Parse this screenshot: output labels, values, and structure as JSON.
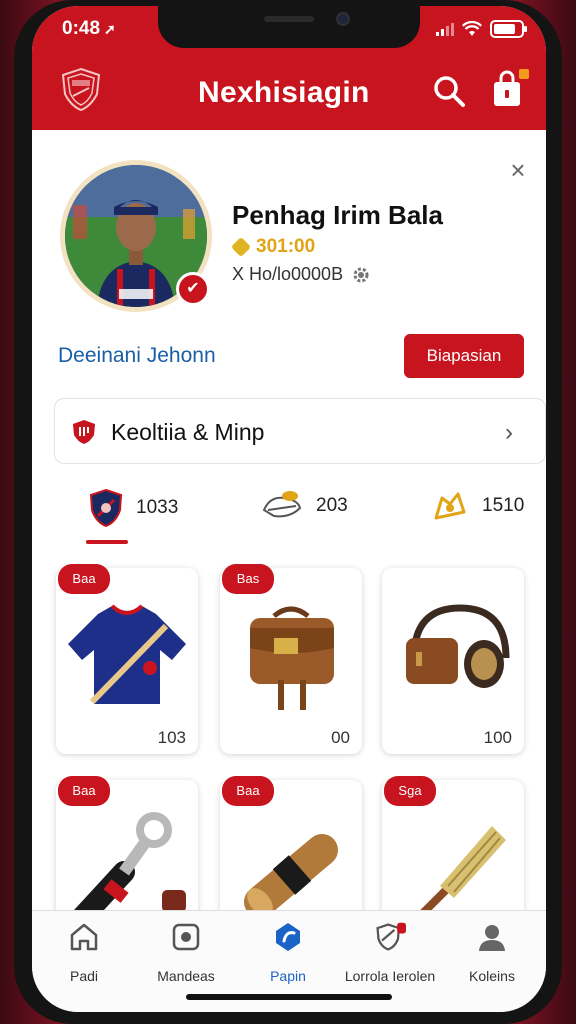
{
  "status": {
    "time": "0:48",
    "arrow": "➚"
  },
  "header": {
    "title": "Nexhisiagin"
  },
  "profile": {
    "name": "Penhag Irim Bala",
    "coins": "301:00",
    "id": "X Ho/lo0000B",
    "link": "Deeinani Jehonn",
    "action_label": "Biapasian"
  },
  "promo": {
    "label": "Keoltiia & Minp"
  },
  "stats": [
    {
      "value": "1033"
    },
    {
      "value": "203"
    },
    {
      "value": "1510"
    }
  ],
  "products": [
    {
      "tag": "Baa",
      "count": "103",
      "icon": "jersey-icon"
    },
    {
      "tag": "Bas",
      "count": "00",
      "icon": "satchel-icon"
    },
    {
      "tag": "",
      "count": "100",
      "icon": "headphones-icon"
    },
    {
      "tag": "Baa",
      "count": "",
      "icon": "bottle-opener-icon"
    },
    {
      "tag": "Baa",
      "count": "",
      "icon": "roller-icon"
    },
    {
      "tag": "Sga",
      "count": "",
      "icon": "broom-icon"
    }
  ],
  "tabs": [
    {
      "label": "Padi"
    },
    {
      "label": "Mandeas"
    },
    {
      "label": "Papin"
    },
    {
      "label": "Lorrola Ierolen"
    },
    {
      "label": "Koleins"
    }
  ],
  "colors": {
    "brand": "#c8141e",
    "active": "#1a64c8",
    "link": "#1a5fa6",
    "coin": "#e0a416"
  }
}
